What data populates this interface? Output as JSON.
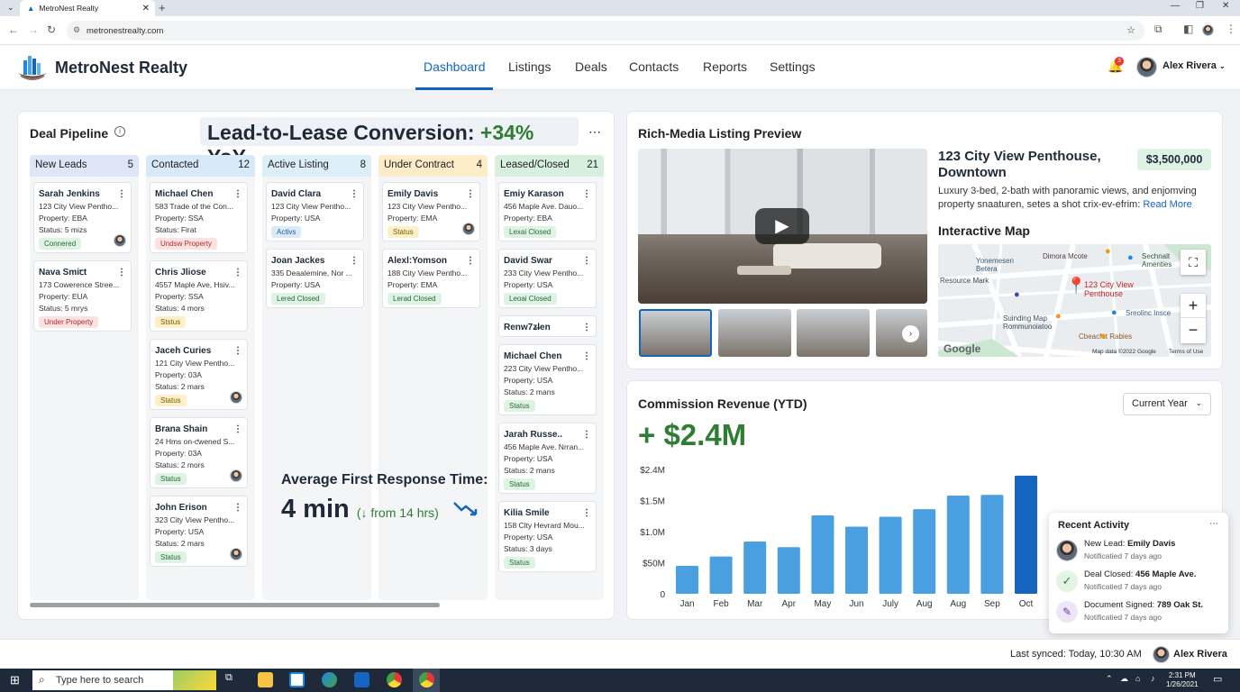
{
  "browser": {
    "tab_title": "MetroNest Realty",
    "url": "metronestrealty.com"
  },
  "app": {
    "brand": "MetroNest Realty",
    "nav": [
      "Dashboard",
      "Listings",
      "Deals",
      "Contacts",
      "Reports",
      "Settings"
    ],
    "active_nav": "Dashboard",
    "notifications": "3",
    "user": "Alex Rivera"
  },
  "pipeline": {
    "title": "Deal Pipeline",
    "conversion": {
      "label": "Lead-to-Lease Conversion: ",
      "value": "+34%",
      "suffix": " YoY"
    },
    "columns": [
      {
        "name": "New Leads",
        "count": "5",
        "color": "#dfe6f7",
        "cards": [
          {
            "name": "Sarah Jenkins",
            "address": "123 City View Pentho...",
            "property": "Property: EBA",
            "status": "Status: 5 mizs",
            "badge": "Connered",
            "badge_type": "green",
            "avatar": true
          },
          {
            "name": "Nava Smiꞇt",
            "address": "173 Cowerence Stree...",
            "property": "Property: EUA",
            "status": "Status: 5 mrys",
            "badge": "Under Property",
            "badge_type": "red",
            "avatar": false
          }
        ]
      },
      {
        "name": "Contacted",
        "count": "12",
        "color": "#d8e9f9",
        "cards": [
          {
            "name": "Michael Chen",
            "address": "583 Trade of the Con...",
            "property": "Property: SSA",
            "status": "Status: Firat",
            "badge": "Undsw Property",
            "badge_type": "red",
            "avatar": false
          },
          {
            "name": "Chris Jliose",
            "address": "4557 Maple Ave, Hsiv...",
            "property": "Property: SSA",
            "status": "Status: 4 mors",
            "badge": "Ststus",
            "badge_type": "yellow",
            "avatar": false
          },
          {
            "name": "Jaceh Curies",
            "address": "121 City View Pentho...",
            "property": "Property: 03A",
            "status": "Status: 2 mars",
            "badge": "Status",
            "badge_type": "yellow",
            "avatar": true
          },
          {
            "name": "Brana Shain",
            "address": "24 Hms on-ƈwened S...",
            "property": "Property: 03A",
            "status": "Status: 2 mors",
            "badge": "Status",
            "badge_type": "green",
            "avatar": true
          },
          {
            "name": "John Erison",
            "address": "323 City View Pentho...",
            "property": "Property: USA",
            "status": "Status: 2 mars",
            "badge": "Status",
            "badge_type": "green",
            "avatar": true
          }
        ]
      },
      {
        "name": "Active Listing",
        "count": "8",
        "color": "#dceef8",
        "cards": [
          {
            "name": "David Clara",
            "address": "123 City View Pentho...",
            "property": "Property: USA",
            "status": "",
            "badge": "Activs",
            "badge_type": "blue",
            "avatar": false
          },
          {
            "name": "Joan Jackes",
            "address": "335 Deaalemine, Nor ...",
            "property": "Property: USA",
            "status": "",
            "badge": "Lered Closed",
            "badge_type": "green",
            "avatar": false
          }
        ]
      },
      {
        "name": "Under Contract",
        "count": "4",
        "color": "#fdecc8",
        "cards": [
          {
            "name": "Emily Davis",
            "address": "123 City View Pentho...",
            "property": "Property: EMA",
            "status": "",
            "badge": "Status",
            "badge_type": "yellow",
            "avatar": true
          },
          {
            "name": "Alexl:Yomson",
            "address": "188 City View Pentho...",
            "property": "Property: EMA",
            "status": "",
            "badge": "Lerad Closed",
            "badge_type": "green",
            "avatar": false
          }
        ]
      },
      {
        "name": "Leased/Closed",
        "count": "21",
        "color": "#d7f0dd",
        "cards": [
          {
            "name": "Emiy Karason",
            "address": "456 Maple Ave. Dauo...",
            "property": "Property: EBA",
            "status": "",
            "badge": "Lexai Closed",
            "badge_type": "green",
            "avatar": false
          },
          {
            "name": "David Swar",
            "address": "233 City View Pentho...",
            "property": "Property: USA",
            "status": "",
            "badge": "Leoai Closed",
            "badge_type": "green",
            "avatar": false
          },
          {
            "name": "Renw7z̶len",
            "address": "",
            "property": "",
            "status": "",
            "badge": "",
            "badge_type": "",
            "avatar": false
          },
          {
            "name": "Michael Chen",
            "address": "223 City View Pentho...",
            "property": "Property: USA",
            "status": "Status: 2 mans",
            "badge": "Status",
            "badge_type": "green",
            "avatar": false
          },
          {
            "name": "Jarah Russe..",
            "address": "456 Maple Ave. Nrran...",
            "property": "Property: USA",
            "status": "Status: 2 mans",
            "badge": "Status",
            "badge_type": "green",
            "avatar": false
          },
          {
            "name": "Kilia Smile",
            "address": "158 Clty Hevrard Mou...",
            "property": "Property: USA",
            "status": "Status: 3 days",
            "badge": "Status",
            "badge_type": "green",
            "avatar": false
          }
        ]
      }
    ],
    "response": {
      "label": "Average First Response Time:",
      "value": "4 min",
      "delta": "(↓ from 14 hrs)"
    }
  },
  "listing": {
    "title": "Rich-Media Listing Preview",
    "name": "123 City View Penthouse, Downtown",
    "price": "$3,500,000",
    "description": "Luxury 3-bed, 2-bath with panoramic views, and enjomving property snaaturen, setes a shot ꞇrix-ev-efrim:",
    "read_more": "Read More",
    "map_title": "Interactive Map",
    "map_labels": [
      "Yonemesen Betera",
      "Dimora Mcote",
      "Sechnalt Amenties",
      "Resource Mark",
      "123 City View Penthouse",
      "Suinding Map Rommunoiatoo",
      "Sreolinc Insce",
      "Cbeacfot Rabies"
    ],
    "map_attribution": "Map data ©2022 Google",
    "map_terms": "Terms of Use",
    "google": "Google"
  },
  "revenue": {
    "title": "Commission Revenue (YTD)",
    "period": "Current Year",
    "total": "+ $2.4M"
  },
  "chart_data": {
    "type": "bar",
    "categories": [
      "Jan",
      "Feb",
      "Mar",
      "Apr",
      "May",
      "Jun",
      "July",
      "Aug",
      "Aug",
      "Sep",
      "Oct"
    ],
    "values": [
      0.45,
      0.6,
      0.84,
      0.75,
      1.26,
      1.08,
      1.24,
      1.36,
      1.58,
      1.59,
      1.9
    ],
    "yticks": [
      "0",
      "$50M",
      "$1.0M",
      "$1.5M",
      "$2.4M"
    ],
    "ytick_values": [
      0,
      0.5,
      1.0,
      1.5,
      2.0
    ],
    "ylim": [
      0,
      2.0
    ],
    "highlight_index": 10,
    "bar_color": "#4a9fe0",
    "highlight_color": "#1565c0",
    "grid": false
  },
  "activity": {
    "title": "Recent Activity",
    "items": [
      {
        "prefix": "New Lead: ",
        "bold": "Emily Davis",
        "time": "Notificatied 7 days ago",
        "icon": "avatar-icon"
      },
      {
        "prefix": "Deal Closed: ",
        "bold": "456 Maple Ave.",
        "time": "Notificatied 7 days ago",
        "icon": "check-circle-icon"
      },
      {
        "prefix": "Document Signed: ",
        "bold": "789 Oak St.",
        "time": "Notificatied 7 days ago",
        "icon": "document-icon"
      }
    ]
  },
  "footer": {
    "synced": "Last synced: Today, 10:30 AM",
    "user": "Alex Rivera"
  },
  "taskbar": {
    "search_placeholder": "Type here to search",
    "time": "2:31 PM",
    "date": "1/26/2021"
  },
  "colors": {
    "accent": "#1565c0",
    "positive": "#2e7d32"
  }
}
